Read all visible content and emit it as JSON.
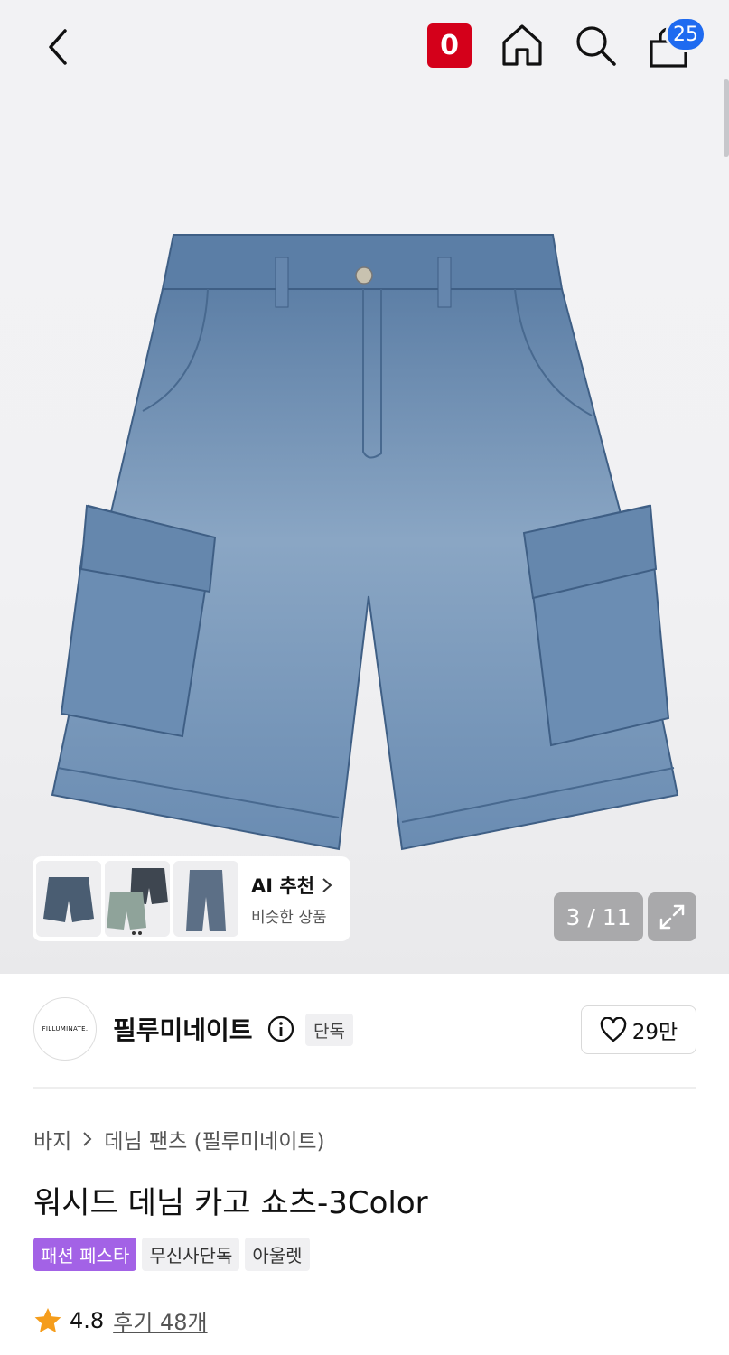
{
  "header": {
    "logo_label": "0",
    "cart_count": "25",
    "icons": [
      "back-icon",
      "home-icon",
      "search-icon",
      "shopping-bag-icon"
    ]
  },
  "gallery": {
    "counter": "3 / 11",
    "ai": {
      "title": "AI 추천",
      "subtitle": "비슷한 상품"
    }
  },
  "brand": {
    "logo_text": "FILLUMINATE.",
    "name": "필루미네이트",
    "badge": "단독",
    "likes": "29만"
  },
  "product": {
    "breadcrumb": [
      "바지",
      "데님 팬츠 (필루미네이트)"
    ],
    "title": "워시드 데님 카고 쇼츠-3Color",
    "tags": [
      {
        "label": "패션 페스타",
        "style": "purple"
      },
      {
        "label": "무신사단독",
        "style": "gray"
      },
      {
        "label": "아울렛",
        "style": "gray"
      }
    ],
    "rating": "4.8",
    "reviews": "후기 48개"
  },
  "colors": {
    "brand_red": "#d4001a",
    "badge_blue": "#1f6bf0",
    "tag_purple": "#a362e6",
    "star": "#f59d1c",
    "denim": "#6d8fb3"
  }
}
